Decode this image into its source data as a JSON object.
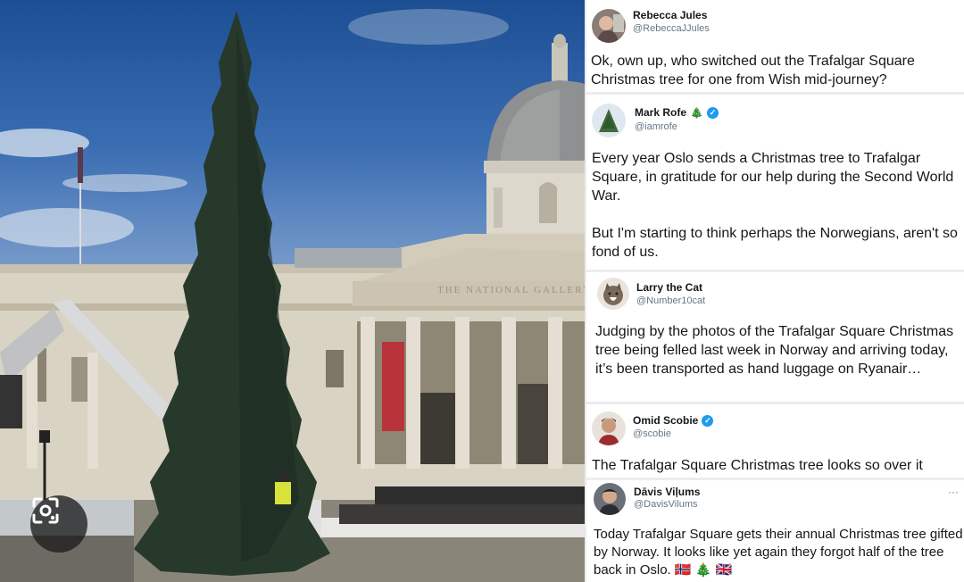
{
  "photo": {
    "banner_text": "THE NATIONAL GALLERY",
    "pediment_text": "THE NATIONAL GALLERY",
    "lens_icon": "image-search-icon"
  },
  "tweets": [
    {
      "name": "Rebecca Jules",
      "name_emoji": "",
      "verified": false,
      "handle": "@RebeccaJJules",
      "text": "Ok, own up, who switched out the Trafalgar Square Christmas tree for one from Wish mid-journey?"
    },
    {
      "name": "Mark Rofe",
      "name_emoji": "🎄",
      "verified": true,
      "handle": "@iamrofe",
      "text": "Every year Oslo sends a Christmas tree to Trafalgar Square, in gratitude for our help during the Second World War.\n\nBut I'm starting to think perhaps the Norwegians, aren't so fond of us."
    },
    {
      "name": "Larry the Cat",
      "name_emoji": "",
      "verified": false,
      "handle": "@Number10cat",
      "text": "Judging by the photos of the Trafalgar Square Christmas tree being felled last week in Norway and arriving today, it’s been transported as hand luggage on Ryanair…"
    },
    {
      "name": "Omid Scobie",
      "name_emoji": "",
      "verified": true,
      "handle": "@scobie",
      "text": "The Trafalgar Square Christmas tree looks so over it"
    },
    {
      "name": "Dāvis Viļums",
      "name_emoji": "",
      "verified": false,
      "handle": "@DavisVilums",
      "more": "···",
      "text": "Today Trafalgar Square gets their annual Christmas tree gifted by Norway. It looks like yet again they forgot half of the tree back in Oslo. 🇳🇴 🎄 🇬🇧"
    }
  ],
  "verified_glyph": "✓",
  "colors": {
    "link": "#1d9bf0",
    "text": "#14171a",
    "muted": "#657786",
    "banner": "#b9333b"
  }
}
